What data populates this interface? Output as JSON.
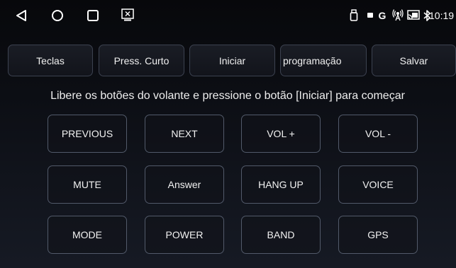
{
  "status_bar": {
    "icons": [
      "back-icon",
      "home-icon",
      "recents-icon",
      "screen-icon",
      "usb-icon",
      "battery-small-icon",
      "google-icon",
      "wireless-icon",
      "cast-icon",
      "bluetooth-icon",
      "location-icon",
      "wifi-icon"
    ],
    "time": "10:19",
    "google_letter": "G"
  },
  "top_buttons": [
    {
      "label": "Teclas"
    },
    {
      "label": "Press. Curto"
    },
    {
      "label": "Iniciar"
    },
    {
      "label": "programação"
    },
    {
      "label": "Salvar"
    }
  ],
  "instruction": "Libere os botões do volante e pressione o botão [Iniciar] para começar",
  "keys": [
    {
      "label": "PREVIOUS"
    },
    {
      "label": "NEXT"
    },
    {
      "label": "VOL +"
    },
    {
      "label": "VOL -"
    },
    {
      "label": "MUTE"
    },
    {
      "label": "Answer"
    },
    {
      "label": "HANG UP"
    },
    {
      "label": "VOICE"
    },
    {
      "label": "MODE"
    },
    {
      "label": "POWER"
    },
    {
      "label": "BAND"
    },
    {
      "label": "GPS"
    }
  ],
  "colors": {
    "background": "#0c0e14",
    "button_border": "#525a6a",
    "text": "#f2f2f2"
  }
}
